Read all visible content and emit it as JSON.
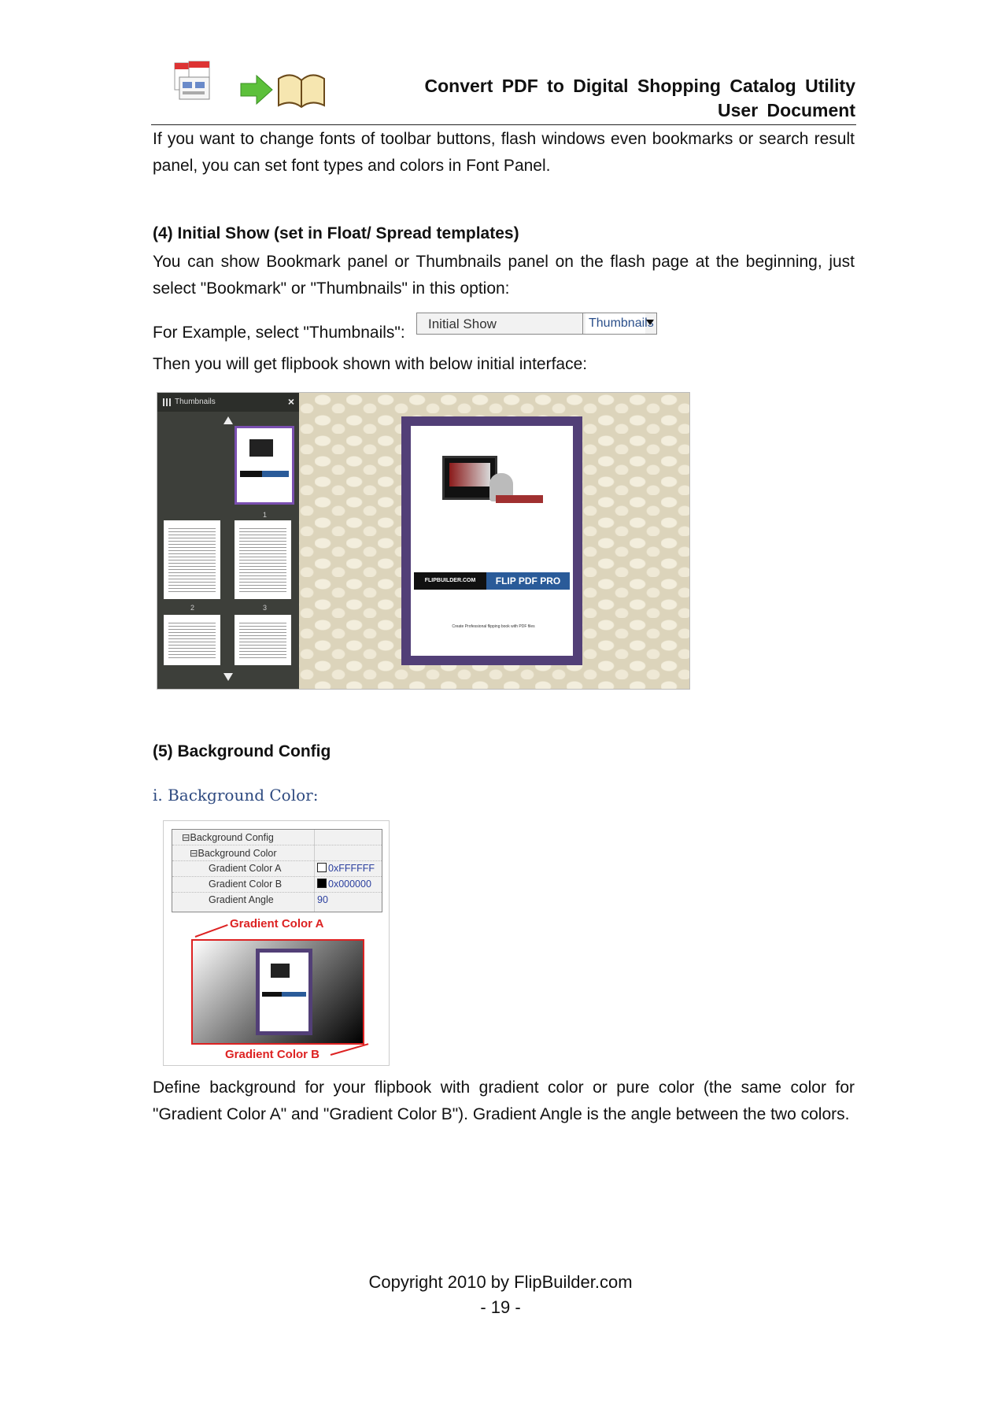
{
  "header": {
    "title_line1": "Convert PDF to Digital Shopping Catalog Utility",
    "title_line2": "User Document",
    "logo_icons": [
      "pdf-files-icon",
      "green-arrow-icon",
      "open-book-icon"
    ]
  },
  "intro": "If you want to change fonts of toolbar buttons, flash windows even bookmarks or search result panel, you can set font types and colors in Font Panel.",
  "section4": {
    "heading": "(4) Initial Show (set in Float/ Spread templates)",
    "body": "You can show Bookmark panel or Thumbnails panel on the flash page at the beginning, just select \"Bookmark\" or \"Thumbnails\" in this option:",
    "example_label": "For Example, select \"Thumbnails\":",
    "select": {
      "label": "Initial Show",
      "value": "Thumbnails"
    },
    "result_text": "Then you will get flipbook shown with below initial interface:",
    "screenshot": {
      "panel_title": "Thumbnails",
      "page_numbers": [
        "1",
        "2",
        "3"
      ],
      "banner_left": "FLIPBUILDER.COM",
      "banner_right": "FLIP PDF PRO",
      "tagline": "Create Professional flipping book with PDF files"
    }
  },
  "section5": {
    "heading": "(5) Background Config",
    "subheading": "i. Background Color:",
    "props": {
      "group": "Background Config",
      "subgroup": "Background Color",
      "rows": [
        {
          "key": "Gradient Color A",
          "value": "0xFFFFFF"
        },
        {
          "key": "Gradient Color B",
          "value": "0x000000"
        },
        {
          "key": "Gradient Angle",
          "value": "90"
        }
      ]
    },
    "label_a": "Gradient Color A",
    "label_b": "Gradient Color B",
    "body": "Define background for your flipbook with gradient color or pure color (the same color for \"Gradient Color A\" and \"Gradient Color B\"). Gradient Angle is the angle between the two colors."
  },
  "footer": {
    "copyright": "Copyright 2010 by FlipBuilder.com",
    "page": "- 19 -"
  },
  "colors": {
    "accent_red": "#dd2222",
    "book_purple": "#523f77",
    "link_blue": "#2e4a80"
  }
}
